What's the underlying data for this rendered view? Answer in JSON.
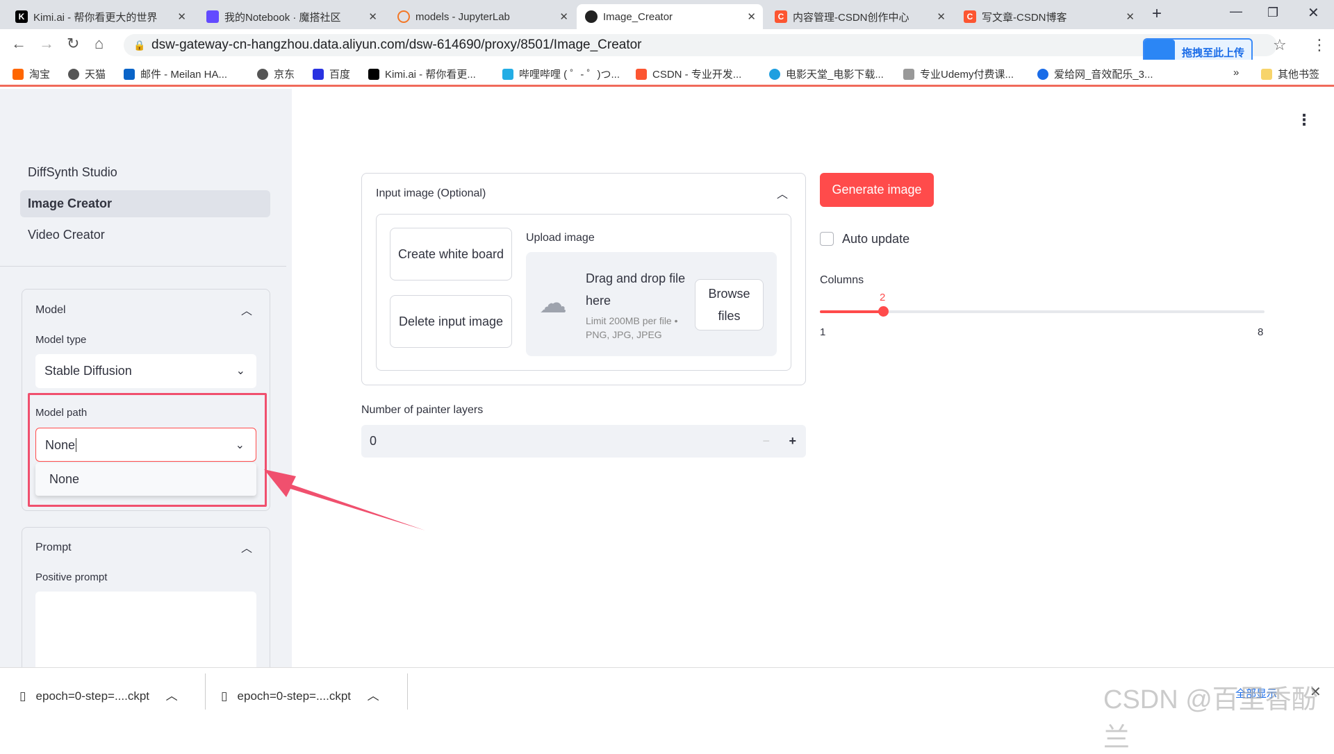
{
  "browser": {
    "tabs": [
      {
        "label": "Kimi.ai - 帮你看更大的世界",
        "color": "#000"
      },
      {
        "label": "我的Notebook · 魔搭社区",
        "color": "#624aff"
      },
      {
        "label": "models - JupyterLab",
        "color": "#f37726"
      },
      {
        "label": "Image_Creator",
        "color": "#222",
        "active": true
      },
      {
        "label": "内容管理-CSDN创作中心",
        "color": "#fc5531"
      },
      {
        "label": "写文章-CSDN博客",
        "color": "#fc5531"
      }
    ],
    "url": "dsw-gateway-cn-hangzhou.data.aliyun.com/dsw-614690/proxy/8501/Image_Creator",
    "upload_ext": "拖拽至此上传",
    "bookmarks": [
      "淘宝",
      "天猫",
      "邮件 - Meilan HA...",
      "京东",
      "百度",
      "Kimi.ai - 帮你看更...",
      "哔哩哔哩 ( ゜- ゜)つ...",
      "CSDN - 专业开发...",
      "电影天堂_电影下载...",
      "专业Udemy付费课...",
      "爱给网_音效配乐_3..."
    ],
    "other_bookmarks": "其他书签"
  },
  "sidebar": {
    "nav": [
      "DiffSynth Studio",
      "Image Creator",
      "Video Creator"
    ],
    "model": {
      "title": "Model",
      "type_label": "Model type",
      "type_value": "Stable Diffusion",
      "path_label": "Model path",
      "path_value": "None",
      "options": [
        "None"
      ]
    },
    "prompt": {
      "title": "Prompt",
      "positive_label": "Positive prompt"
    }
  },
  "main": {
    "input_image": {
      "title": "Input image (Optional)",
      "create_btn": "Create white board",
      "delete_btn": "Delete input image",
      "upload_label": "Upload image",
      "drag_text": "Drag and drop file here",
      "limit_text": "Limit 200MB per file • PNG, JPG, JPEG",
      "browse_btn": "Browse files"
    },
    "generate_btn": "Generate image",
    "auto_update": "Auto update",
    "auto_update_checked": false,
    "columns": {
      "label": "Columns",
      "value": "2",
      "min": "1",
      "max": "8"
    },
    "painter_layers": {
      "label": "Number of painter layers",
      "value": "0"
    }
  },
  "downloads": [
    "epoch=0-step=....ckpt",
    "epoch=0-step=....ckpt"
  ],
  "downloads_show_all": "全部显示",
  "watermark": "CSDN @百里香酚兰",
  "colors": {
    "accent": "#ff4b4b",
    "highlight_box": "#f0506e"
  }
}
